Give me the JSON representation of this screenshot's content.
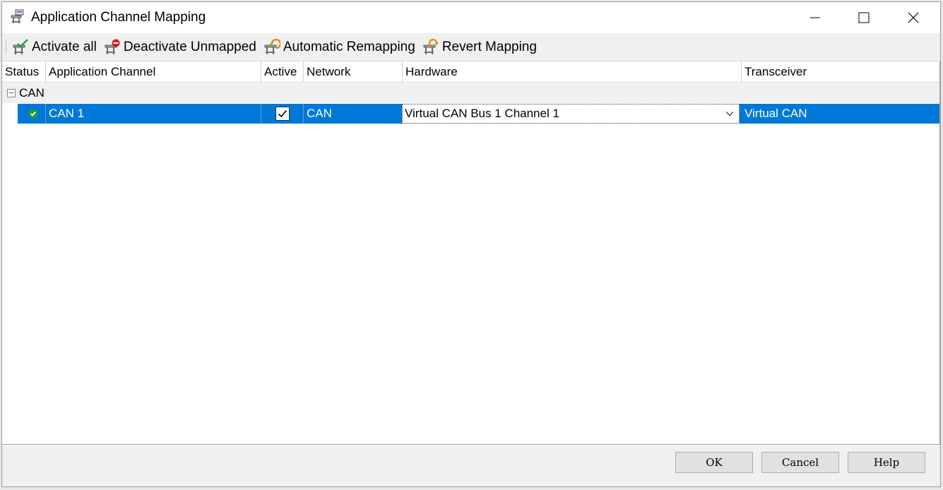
{
  "window": {
    "title": "Application Channel Mapping"
  },
  "toolbar": {
    "activate_all": "Activate all",
    "deactivate_unmapped": "Deactivate Unmapped",
    "automatic_remapping": "Automatic Remapping",
    "revert_mapping": "Revert Mapping"
  },
  "grid": {
    "columns": [
      "Status",
      "Application Channel",
      "Active",
      "Network",
      "Hardware",
      "Transceiver"
    ],
    "groups": [
      {
        "label": "CAN",
        "expanded": true,
        "rows": [
          {
            "status": "ok",
            "application_channel": "CAN 1",
            "active": true,
            "network": "CAN",
            "hardware": "Virtual CAN Bus 1 Channel 1",
            "transceiver": "Virtual CAN",
            "selected": true
          }
        ]
      }
    ]
  },
  "footer": {
    "ok": "OK",
    "cancel": "Cancel",
    "help": "Help"
  },
  "colors": {
    "selection": "#0078d7",
    "status_ok": "#1e9e3a",
    "toolbar_bg": "#f0f0f0"
  },
  "icons": {
    "title": "network-mapping-icon",
    "activate_all": "activate-all-icon",
    "deactivate_unmapped": "deactivate-icon",
    "automatic_remapping": "auto-remap-icon",
    "revert_mapping": "revert-icon"
  }
}
